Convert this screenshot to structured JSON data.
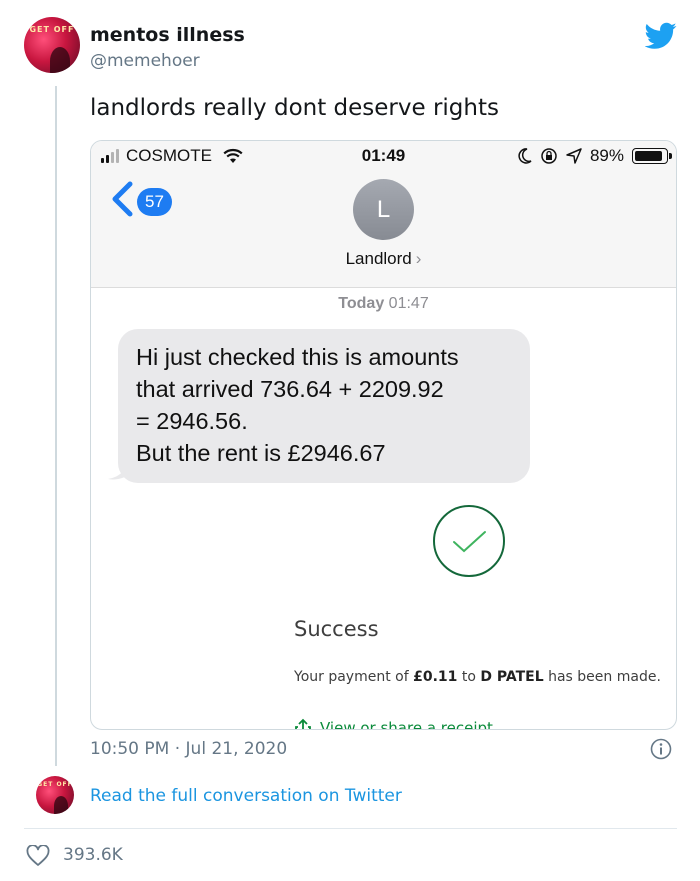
{
  "tweet": {
    "author_name": "mentos illness",
    "author_handle": "@memehoer",
    "text": "landlords really dont deserve rights",
    "timestamp": "10:50 PM · Jul 21, 2020",
    "read_more_link": "Read the full conversation on Twitter",
    "like_count": "393.6K",
    "avatar_text": "GET OFF"
  },
  "phone": {
    "carrier": "COSMOTE",
    "time": "01:49",
    "battery": "89%",
    "battery_level": 0.89,
    "back_count": "57",
    "contact_initial": "L",
    "contact_name": "Landlord",
    "contact_chevron": "›",
    "message_day": "Today",
    "message_time": "01:47",
    "message_lines": [
      "Hi just checked this is amounts",
      "that arrived 736.64 + 2209.92",
      "= 2946.56.",
      "But the rent is £2946.67"
    ]
  },
  "payment": {
    "title": "Success",
    "detail_prefix": "Your payment of ",
    "amount": "£0.11",
    "detail_mid": " to ",
    "payee": "D PATEL",
    "detail_suffix": " has been made.",
    "receipt_link": "View or share a receipt"
  },
  "colors": {
    "twitter_blue": "#1da1f2",
    "link_blue": "#1b95e0",
    "imessage_blue": "#1e7cf2",
    "success_green": "#0a8a3a",
    "bubble_gray": "#e9e9eb"
  },
  "icons": [
    "twitter-bird-icon",
    "signal-bars-icon",
    "wifi-icon",
    "moon-icon",
    "orientation-lock-icon",
    "location-arrow-icon",
    "battery-icon",
    "back-chevron-icon",
    "checkmark-circle-icon",
    "share-icon",
    "info-icon",
    "heart-icon"
  ]
}
